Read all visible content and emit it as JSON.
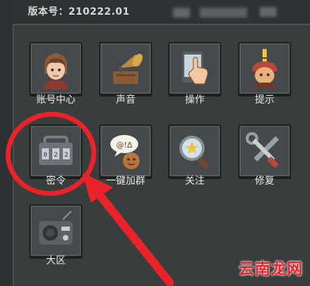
{
  "header": {
    "version_text": "版本号：210222.01"
  },
  "menu": {
    "items": [
      {
        "label": "账号中心",
        "icon": "avatar-icon"
      },
      {
        "label": "声音",
        "icon": "gramophone-icon"
      },
      {
        "label": "操作",
        "icon": "tap-hand-icon"
      },
      {
        "label": "提示",
        "icon": "helmet-hint-icon"
      },
      {
        "label": "密令",
        "icon": "lock-box-icon"
      },
      {
        "label": "一键加群",
        "icon": "chat-bubble-icon"
      },
      {
        "label": "关注",
        "icon": "magnifier-icon"
      },
      {
        "label": "修复",
        "icon": "tools-icon"
      },
      {
        "label": "大区",
        "icon": "radio-icon"
      }
    ]
  },
  "annotation": {
    "color": "#e8232a"
  },
  "watermark": {
    "text": "云南龙网"
  }
}
